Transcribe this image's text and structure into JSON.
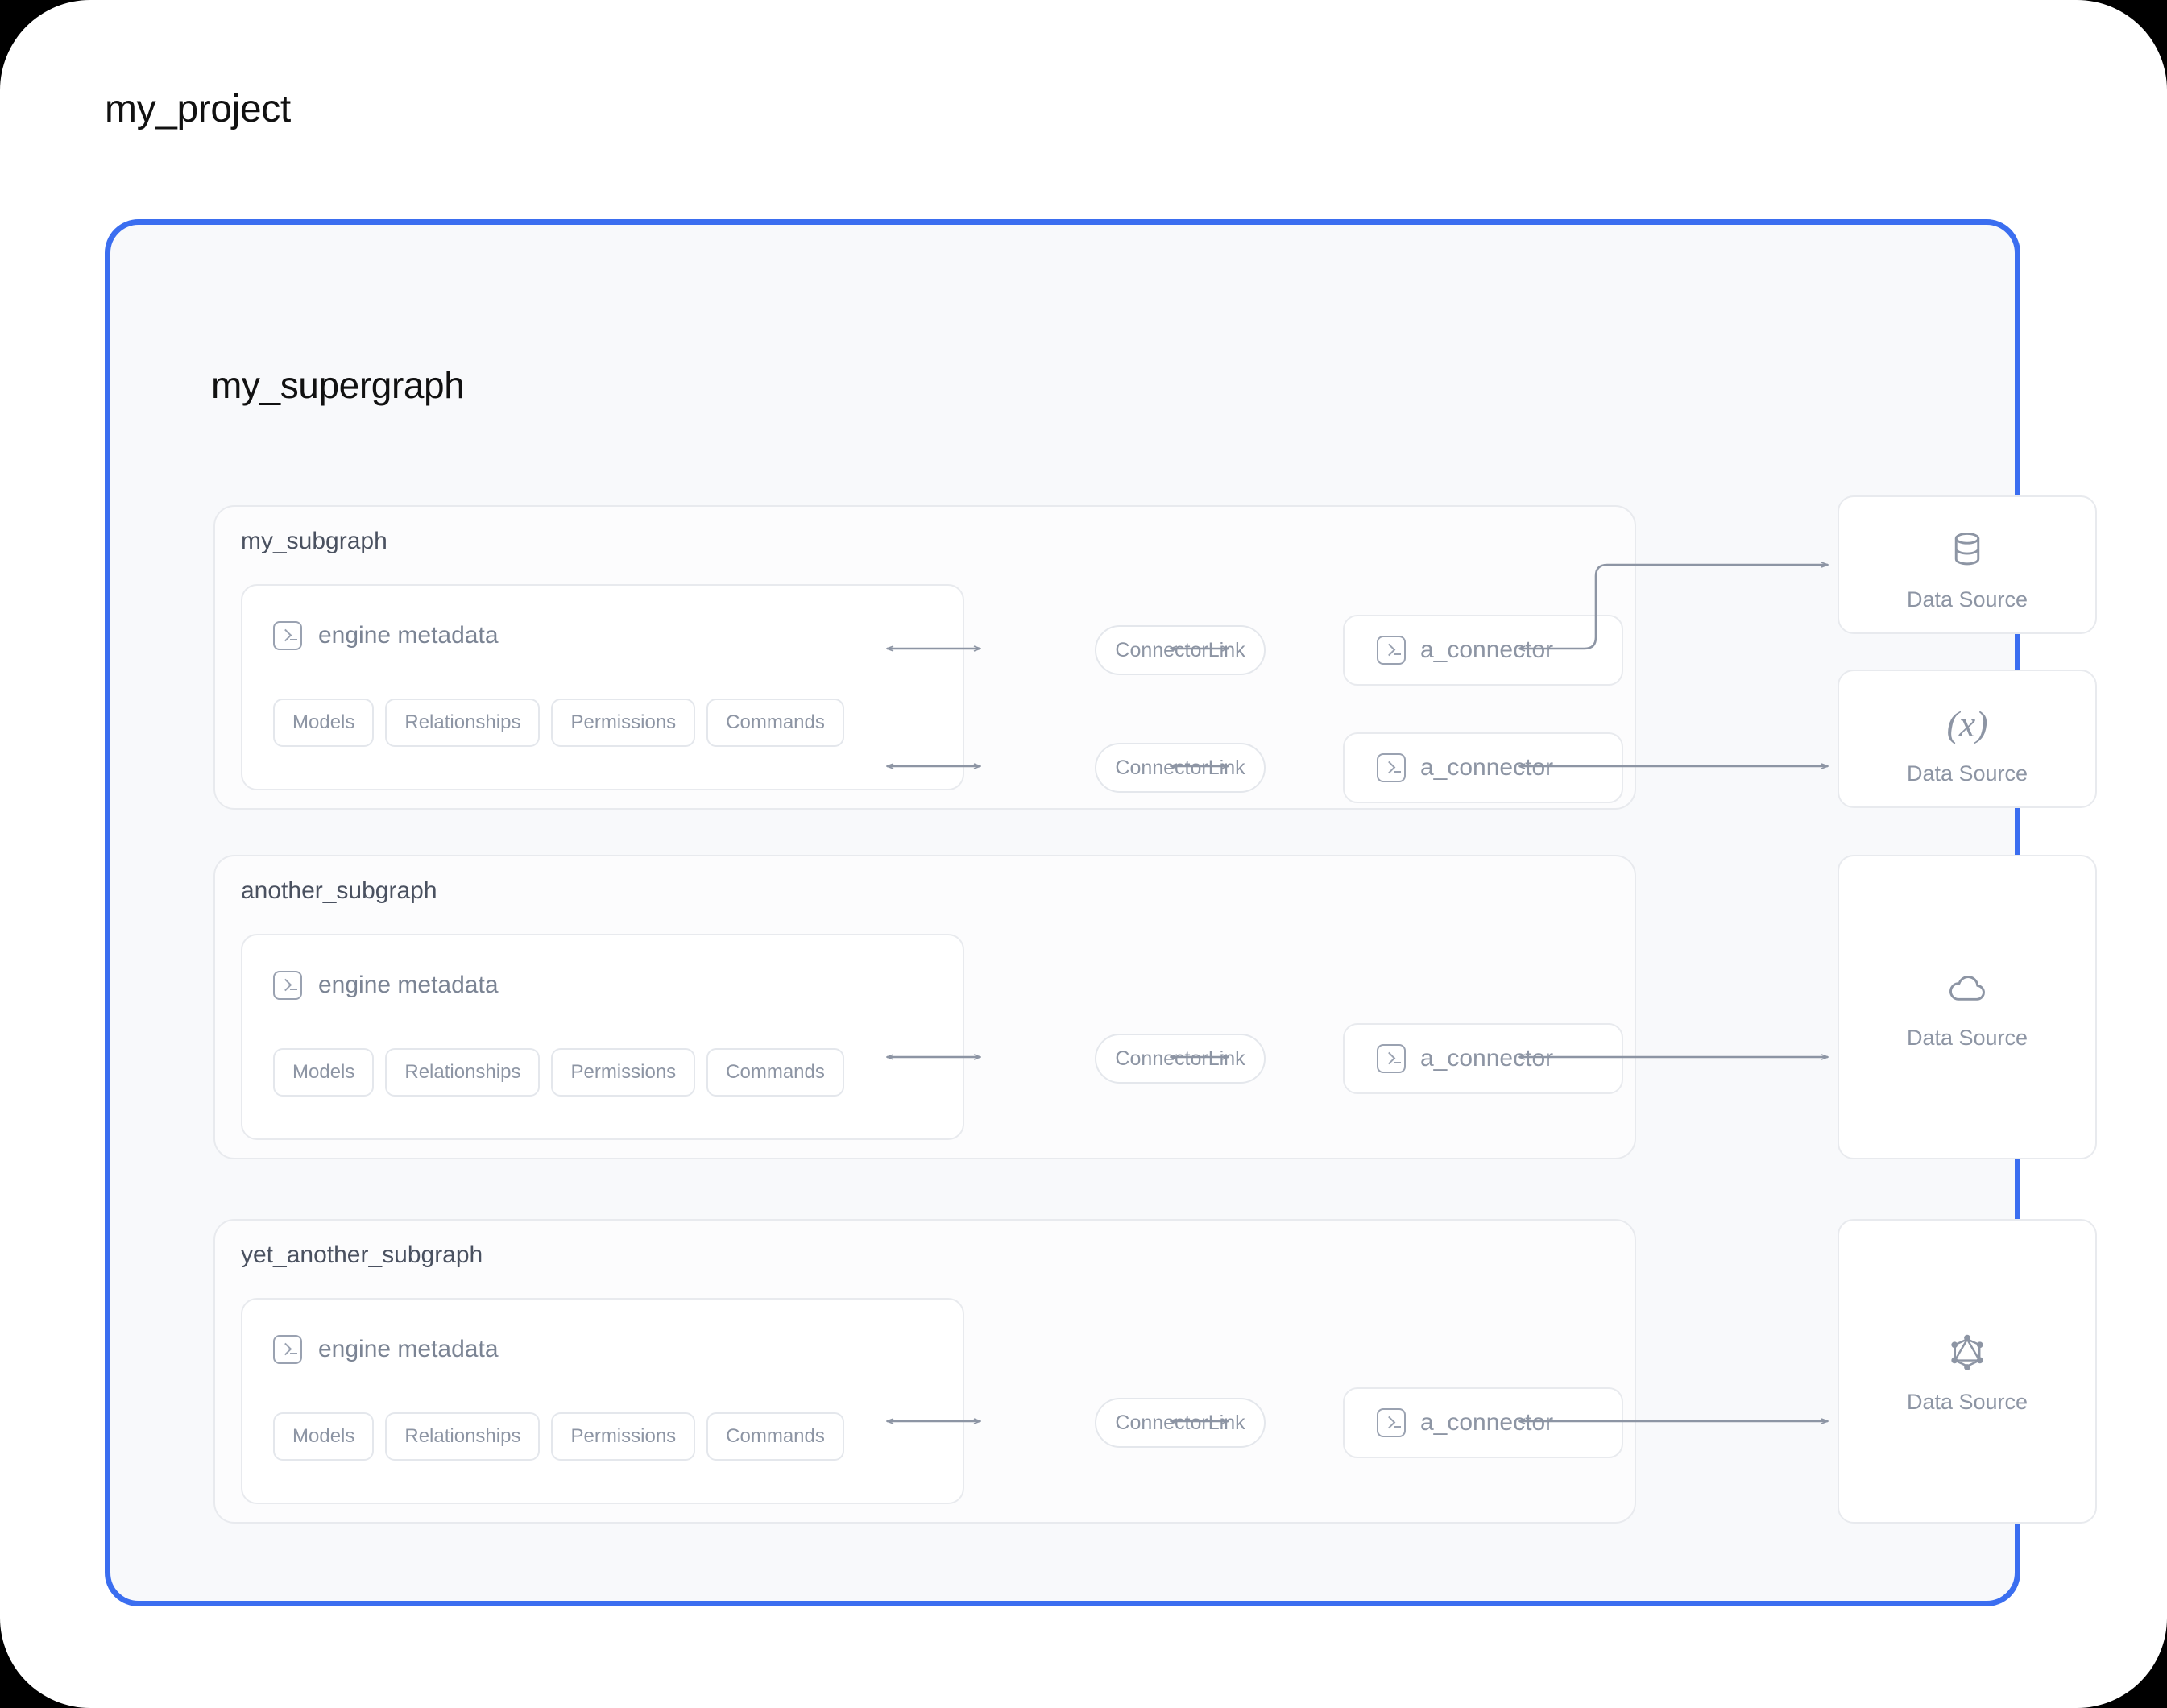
{
  "project": {
    "title": "my_project"
  },
  "supergraph": {
    "title": "my_supergraph"
  },
  "colors": {
    "accent": "#3b6ef0",
    "panel_bg": "#f8f9fb",
    "card_border": "#e8eaee",
    "muted_text": "#8d95a4",
    "edge": "#8d95a4"
  },
  "engine": {
    "label": "engine metadata",
    "icon": "terminal-icon",
    "tags": [
      "Models",
      "Relationships",
      "Permissions",
      "Commands"
    ]
  },
  "subgraphs": [
    {
      "name": "my_subgraph",
      "rows": [
        {
          "link_label": "ConnectorLink",
          "connector_label": "a_connector",
          "connector_icon": "terminal-icon"
        },
        {
          "link_label": "ConnectorLink",
          "connector_label": "a_connector",
          "connector_icon": "terminal-icon"
        }
      ]
    },
    {
      "name": "another_subgraph",
      "rows": [
        {
          "link_label": "ConnectorLink",
          "connector_label": "a_connector",
          "connector_icon": "terminal-icon"
        }
      ]
    },
    {
      "name": "yet_another_subgraph",
      "rows": [
        {
          "link_label": "ConnectorLink",
          "connector_label": "a_connector",
          "connector_icon": "terminal-icon"
        }
      ]
    }
  ],
  "data_sources": [
    {
      "label": "Data Source",
      "icon": "database-icon"
    },
    {
      "label": "Data Source",
      "icon": "function-fx-icon"
    },
    {
      "label": "Data Source",
      "icon": "cloud-icon"
    },
    {
      "label": "Data Source",
      "icon": "graphql-icon"
    }
  ]
}
